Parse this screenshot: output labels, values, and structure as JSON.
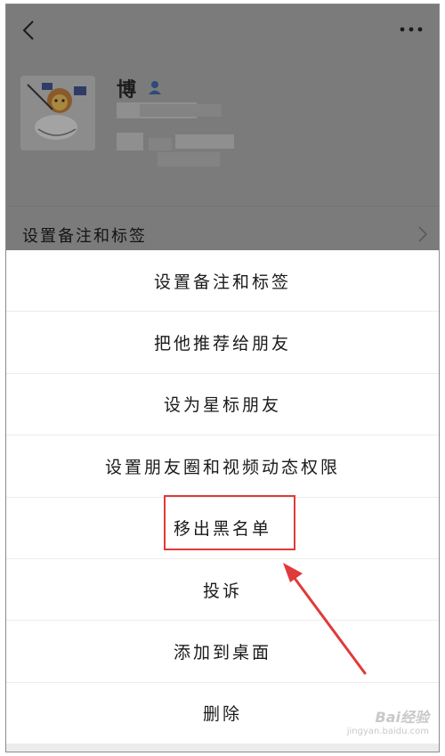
{
  "profile": {
    "name": "博",
    "remark_row_label": "设置备注和标签"
  },
  "action_sheet": {
    "items": [
      "设置备注和标签",
      "把他推荐给朋友",
      "设为星标朋友",
      "设置朋友圈和视频动态权限",
      "移出黑名单",
      "投诉",
      "添加到桌面",
      "删除"
    ],
    "highlighted_item": "移出黑名单"
  },
  "annotation": {
    "color": "#e03a3a"
  },
  "watermark": {
    "main": "Bai经验",
    "sub": "jingyan.baidu.com"
  }
}
